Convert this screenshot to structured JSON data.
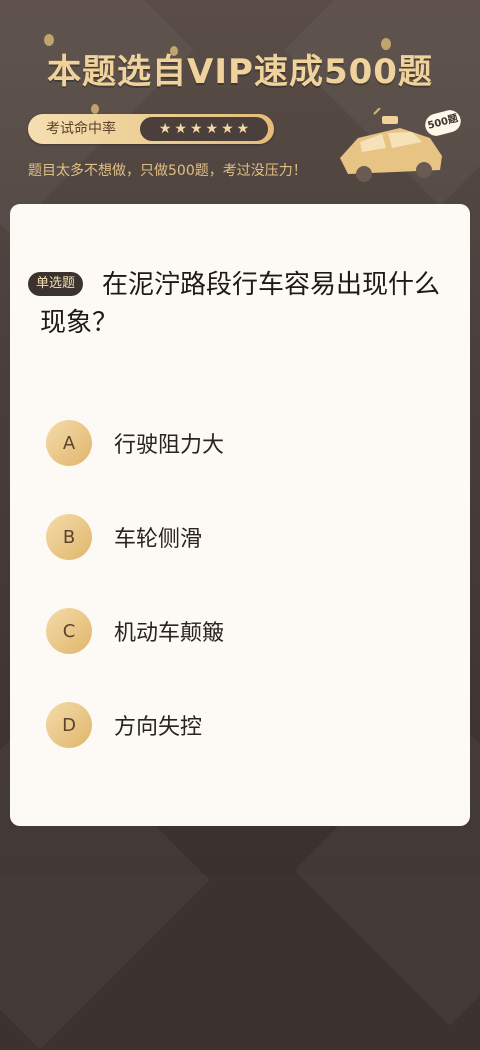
{
  "header": {
    "title": "本题选自VIP速成500题",
    "rate_label": "考试命中率",
    "stars": [
      "★",
      "★",
      "★",
      "★",
      "★",
      "★"
    ],
    "subtitle": "题目太多不想做，只做500题，考过没压力！",
    "badge": "500题"
  },
  "question": {
    "type_tag": "单选题",
    "text": "在泥泞路段行车容易出现什么现象？",
    "options": [
      {
        "letter": "A",
        "text": "行驶阻力大"
      },
      {
        "letter": "B",
        "text": "车轮侧滑"
      },
      {
        "letter": "C",
        "text": "机动车颠簸"
      },
      {
        "letter": "D",
        "text": "方向失控"
      }
    ]
  },
  "colors": {
    "accent": "#e0b56d",
    "background": "#3c332f",
    "card": "#fdfaf5"
  }
}
